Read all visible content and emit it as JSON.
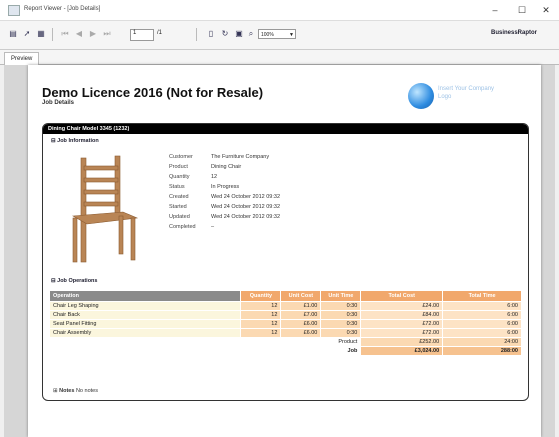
{
  "window": {
    "title": "Report Viewer - [Job Details]",
    "minimize": "–",
    "maximize": "☐",
    "close": "✕"
  },
  "toolbar": {
    "page_value": "1",
    "page_count": "/1",
    "zoom": "100%",
    "brand": "BusinessRaptor"
  },
  "tabs": [
    {
      "label": "Preview"
    }
  ],
  "report": {
    "title": "Demo Licence 2016 (Not for Resale)",
    "subtitle": "Job Details",
    "logo_text": "Insert Your Company Logo",
    "card_header": "Dining Chair Model 3345 (1232)",
    "job_info": {
      "heading": "Job Information",
      "fields": [
        {
          "key": "Customer",
          "value": "The Furniture Company"
        },
        {
          "key": "Product",
          "value": "Dining Chair"
        },
        {
          "key": "Quantity",
          "value": "12"
        },
        {
          "key": "Status",
          "value": "In Progress"
        },
        {
          "key": "Created",
          "value": "Wed 24 October 2012 09:32"
        },
        {
          "key": "Started",
          "value": "Wed 24 October 2012 09:32"
        },
        {
          "key": "Updated",
          "value": "Wed 24 October 2012 09:32"
        },
        {
          "key": "Completed",
          "value": "–"
        }
      ]
    },
    "operations": {
      "heading": "Job Operations",
      "columns": [
        "Operation",
        "Quantity",
        "Unit Cost",
        "Unit Time",
        "Total Cost",
        "Total Time"
      ],
      "rows": [
        {
          "op": "Chair Leg Shaping",
          "qty": "12",
          "ucost": "£1.00",
          "utime": "0:30",
          "tcost": "£24.00",
          "ttime": "6:00"
        },
        {
          "op": "Chair Back",
          "qty": "12",
          "ucost": "£7.00",
          "utime": "0:30",
          "tcost": "£84.00",
          "ttime": "6:00"
        },
        {
          "op": "Seat Panel Fitting",
          "qty": "12",
          "ucost": "£6.00",
          "utime": "0:30",
          "tcost": "£72.00",
          "ttime": "6:00"
        },
        {
          "op": "Chair Assembly",
          "qty": "12",
          "ucost": "£6.00",
          "utime": "0:30",
          "tcost": "£72.00",
          "ttime": "6:00"
        }
      ],
      "product_label": "Product",
      "product_cost": "£252.00",
      "product_time": "24:00",
      "job_label": "Job",
      "job_cost": "£3,024.00",
      "job_time": "288:00"
    },
    "notes": {
      "label": "Notes",
      "value": "No notes"
    }
  }
}
